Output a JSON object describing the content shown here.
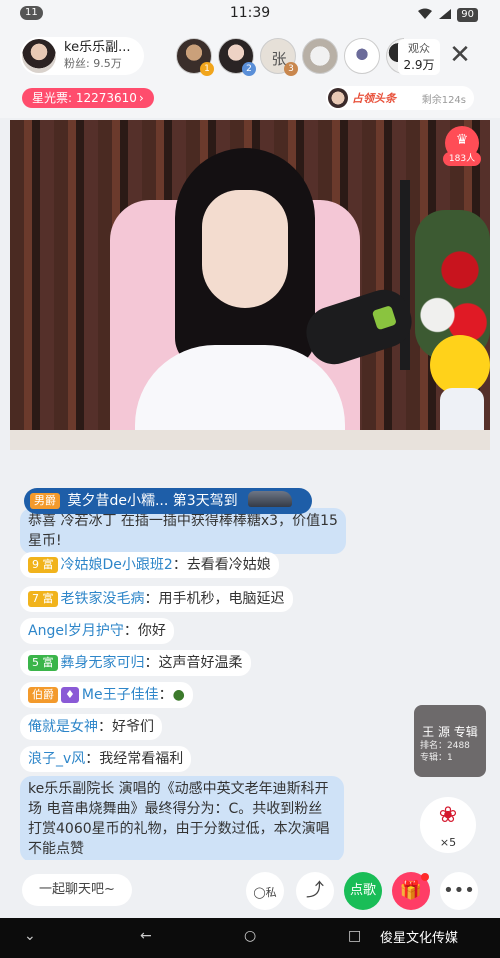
{
  "status": {
    "notif_count": "11",
    "time": "11:39",
    "battery": "90"
  },
  "host": {
    "name": "ke乐乐副...",
    "fans": "粉丝: 9.5万"
  },
  "top_viewers": [
    {
      "rank": "1",
      "label": ""
    },
    {
      "rank": "2",
      "label": ""
    },
    {
      "rank": "3",
      "label": "张"
    },
    {
      "rank": "",
      "label": ""
    },
    {
      "rank": "",
      "label": ""
    },
    {
      "rank": "",
      "label": ""
    }
  ],
  "viewers": {
    "title": "观众",
    "count": "2.9万"
  },
  "starlight": {
    "label": "星光票: 12273610",
    "arrow": "›"
  },
  "headline": {
    "text": "占领头条",
    "remaining": "剩余124s"
  },
  "video_badge": {
    "count": "183人"
  },
  "arrival": {
    "tag": "男爵",
    "name": "莫夕昔de小糯...",
    "text": "第3天驾到"
  },
  "chat": [
    {
      "tag": "",
      "name": "",
      "text": "恭喜 冷若冰丁 在插一插中获得棒棒糖x3，价值15星币!"
    },
    {
      "tag": "9 富",
      "tag_color": "#f1b31c",
      "name": "冷姑娘De小跟班2",
      "text": "：去看看冷姑娘"
    },
    {
      "tag": "7 富",
      "tag_color": "#f1b31c",
      "name": "老铁家没毛病",
      "text": "：用手机秒，电脑延迟"
    },
    {
      "tag": "",
      "name": "Angel岁月护守",
      "text": "：你好"
    },
    {
      "tag": "5 富",
      "tag_color": "#3bb54a",
      "name": "彝身无家可归",
      "text": "：这声音好温柔"
    },
    {
      "tag": "伯爵",
      "tag_color": "#f39a2c",
      "name": "Me王子佳佳",
      "text": "："
    },
    {
      "tag": "",
      "name": "俺就是女神",
      "text": "：好爷们"
    },
    {
      "tag": "",
      "name": "浪子_v风",
      "text": "：我经常看福利"
    },
    {
      "tag": "",
      "name": "",
      "text": "ke乐乐副院长 演唱的《动感中英文老年迪斯科开场 电音串烧舞曲》最终得分为：C。共收到粉丝打赏4060星币的礼物，由于分数过低，本次演唱不能点赞"
    }
  ],
  "song_card": {
    "title": "王 源 专辑",
    "rank": "排名：2488",
    "album": "专辑：1"
  },
  "rose": {
    "icon": "rose-icon",
    "count": "×5"
  },
  "bottom": {
    "chat_placeholder": "一起聊天吧~",
    "private_label": "私",
    "song_label": "点歌"
  },
  "watermark": "俊星文化传媒",
  "colors": {
    "accent": "#ff4d6d",
    "chat_name": "#2e86c9",
    "arrival_bg": "#1e5ea8"
  }
}
